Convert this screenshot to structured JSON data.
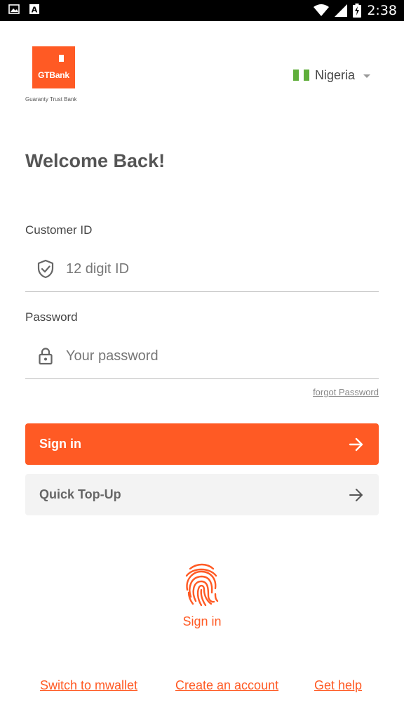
{
  "status_bar": {
    "time": "2:38",
    "icons": [
      "image-icon",
      "font-a-icon",
      "wifi-icon",
      "signal-icon",
      "battery-charging-icon"
    ]
  },
  "header": {
    "logo_text": "GTBank",
    "logo_caption": "Guaranty Trust Bank",
    "country": "Nigeria",
    "flag_colors": [
      "#5fae3b",
      "#ffffff",
      "#5fae3b"
    ]
  },
  "title": "Welcome Back!",
  "form": {
    "customer_id": {
      "label": "Customer ID",
      "placeholder": "12 digit ID",
      "value": "",
      "icon": "shield-check-icon"
    },
    "password": {
      "label": "Password",
      "placeholder": "Your password",
      "value": "",
      "icon": "lock-icon"
    },
    "forgot_password": "forgot Password"
  },
  "actions": {
    "sign_in": "Sign in",
    "quick_top_up": "Quick Top-Up"
  },
  "fingerprint": {
    "label": "Sign in",
    "icon": "fingerprint-icon"
  },
  "footer": {
    "links": [
      "Switch to mwallet",
      "Create an account",
      "Get help"
    ]
  },
  "colors": {
    "brand": "#ff5a24",
    "secondary_button": "#f3f3f3",
    "text": "#555555"
  }
}
